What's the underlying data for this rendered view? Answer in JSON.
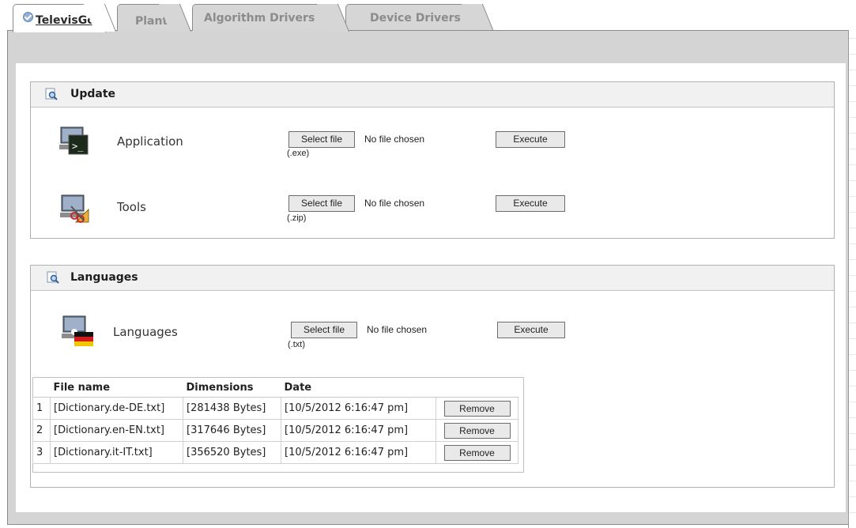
{
  "tabs": [
    {
      "label": "TelevisGo",
      "active": true
    },
    {
      "label": "Plant",
      "active": false
    },
    {
      "label": "Algorithm Drivers",
      "active": false
    },
    {
      "label": "Device Drivers",
      "active": false
    }
  ],
  "update": {
    "title": "Update",
    "rows": [
      {
        "label": "Application",
        "select_label": "Select file",
        "file_status": "No file chosen",
        "ext": "(.exe)",
        "execute_label": "Execute",
        "icon": "terminal-monitor-icon"
      },
      {
        "label": "Tools",
        "select_label": "Select file",
        "file_status": "No file chosen",
        "ext": "(.zip)",
        "execute_label": "Execute",
        "icon": "tools-monitor-icon"
      }
    ]
  },
  "languages": {
    "title": "Languages",
    "row": {
      "label": "Languages",
      "select_label": "Select file",
      "file_status": "No file chosen",
      "ext": "(.txt)",
      "execute_label": "Execute",
      "icon": "language-flag-monitor-icon"
    },
    "table": {
      "headers": [
        "File name",
        "Dimensions",
        "Date"
      ],
      "rows": [
        {
          "index": "1",
          "file": "[Dictionary.de-DE.txt]",
          "size": "[281438 Bytes]",
          "date": "[10/5/2012 6:16:47 pm]",
          "action": "Remove"
        },
        {
          "index": "2",
          "file": "[Dictionary.en-EN.txt]",
          "size": "[317646 Bytes]",
          "date": "[10/5/2012 6:16:47 pm]",
          "action": "Remove"
        },
        {
          "index": "3",
          "file": "[Dictionary.it-IT.txt]",
          "size": "[356520 Bytes]",
          "date": "[10/5/2012 6:16:47 pm]",
          "action": "Remove"
        }
      ]
    }
  }
}
